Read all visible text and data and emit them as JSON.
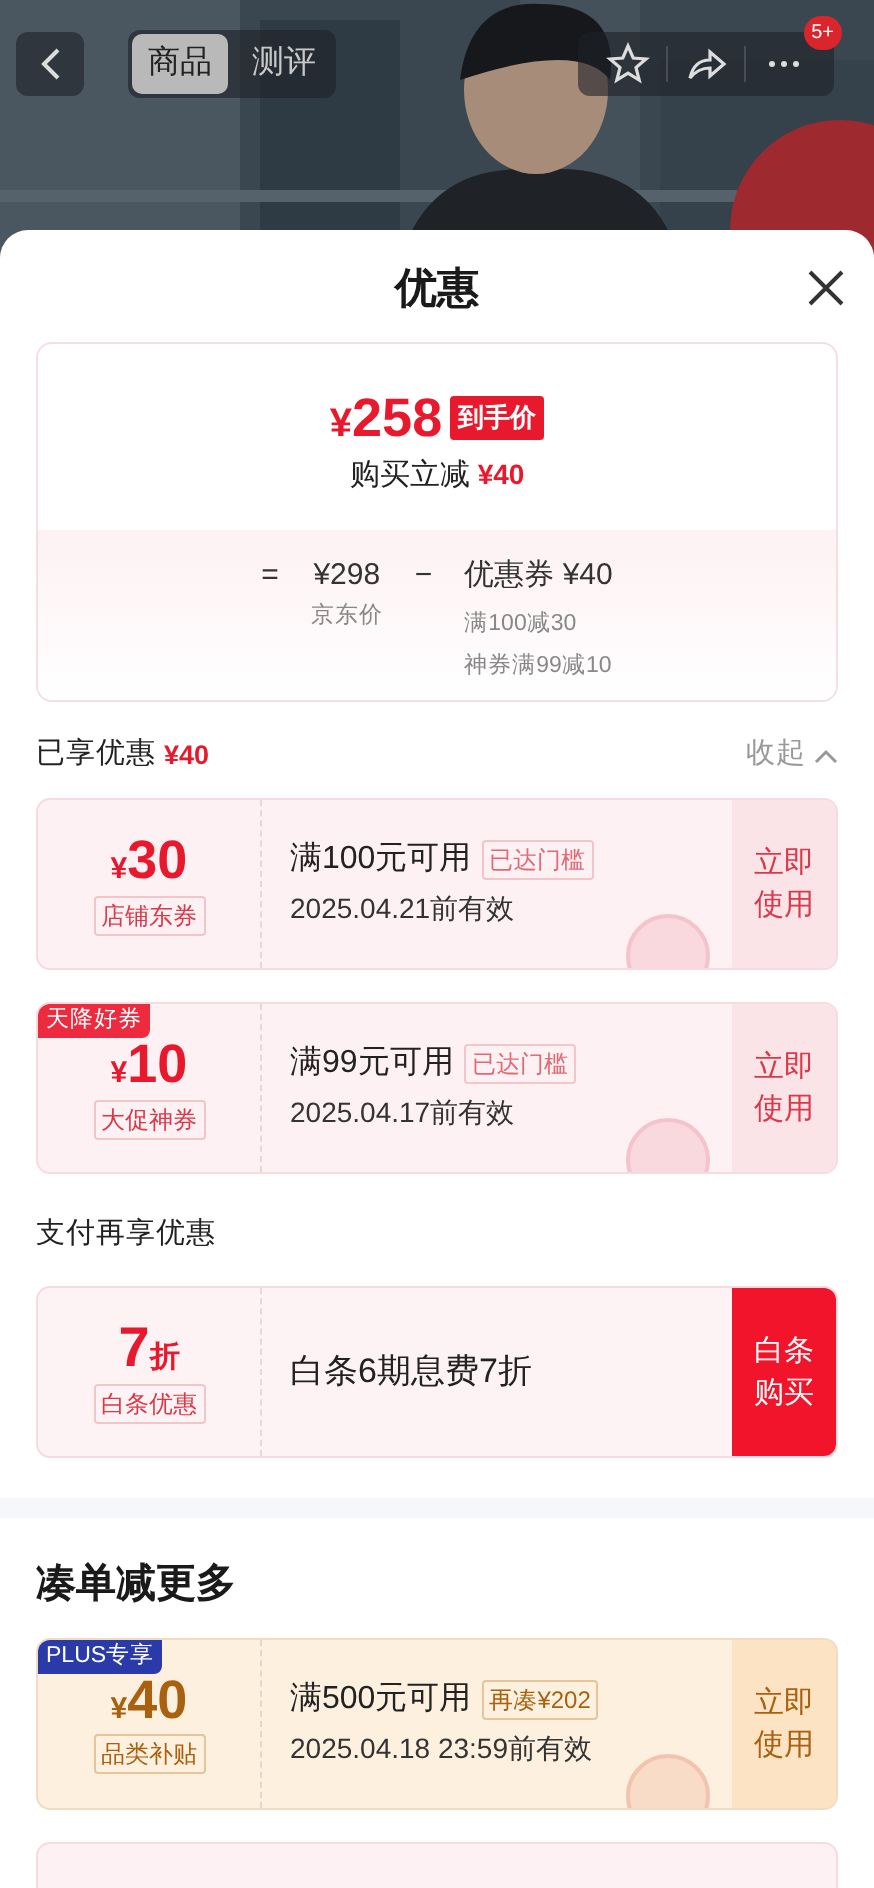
{
  "nav": {
    "tabs": [
      {
        "label": "商品",
        "selected": true
      },
      {
        "label": "测评",
        "selected": false
      }
    ],
    "badge": "5+"
  },
  "sheet": {
    "title": "优惠"
  },
  "summary": {
    "price_symbol": "¥",
    "price": "258",
    "price_tag": "到手价",
    "cut_label": "购买立减",
    "cut_amount": "¥40",
    "equals": "=",
    "base_price": "¥298",
    "base_label": "京东价",
    "minus": "−",
    "coupon_total": "优惠券 ¥40",
    "coupon_details": [
      "满100减30",
      "神券满99减10"
    ]
  },
  "enjoyed": {
    "title": "已享优惠",
    "amount": "¥40",
    "toggle": "收起"
  },
  "coupons": [
    {
      "kind": "pink",
      "symbol": "¥",
      "amount": "30",
      "type": "店铺东券",
      "condition": "满100元可用",
      "status": "已达门槛",
      "validity": "2025.04.21前有效",
      "action": "立即使用"
    },
    {
      "kind": "pink",
      "corner_tag": "天降好券",
      "symbol": "¥",
      "amount": "10",
      "type": "大促神券",
      "condition": "满99元可用",
      "status": "已达门槛",
      "validity": "2025.04.17前有效",
      "action": "立即使用"
    }
  ],
  "pay": {
    "title": "支付再享优惠",
    "offer": {
      "value": "7",
      "unit": "折",
      "type": "白条优惠",
      "description": "白条6期息费7折",
      "action": "白条购买"
    }
  },
  "more": {
    "title": "凑单减更多",
    "coupons": [
      {
        "kind": "gold",
        "corner_tag": "PLUS专享",
        "symbol": "¥",
        "amount": "40",
        "type": "品类补贴",
        "condition": "满500元可用",
        "status": "再凑¥202",
        "validity": "2025.04.18 23:59前有效",
        "action": "立即使用"
      },
      {
        "kind": "pink",
        "cut_off": true
      }
    ]
  }
}
